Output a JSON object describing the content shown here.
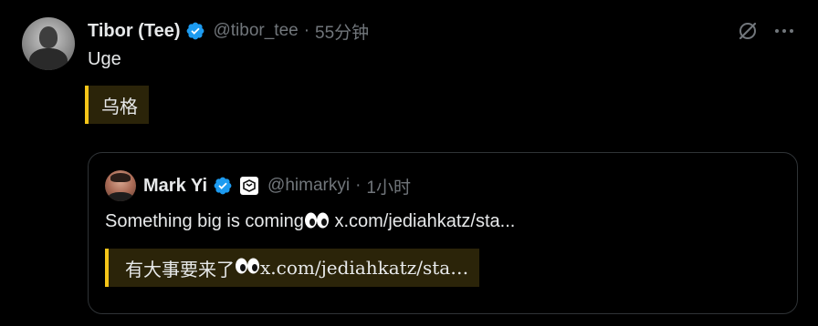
{
  "tweet": {
    "author_name": "Tibor (Tee)",
    "handle": "@tibor_tee",
    "separator": "·",
    "time": "55分钟",
    "text": "Uge",
    "translation": "乌格"
  },
  "quoted_tweet": {
    "author_name": "Mark Yi",
    "handle": "@himarkyi",
    "separator": "·",
    "time": "1小时",
    "text_before_emoji": "Something big is coming",
    "text_after_emoji": " x.com/jediahkatz/sta...",
    "translation_before_emoji": "有大事要来了 ",
    "translation_after_emoji": " x.com/jediahkatz/sta…"
  },
  "icons": {
    "verified": "verified-badge-icon",
    "affiliate": "affiliate-badge-icon",
    "grok": "grok-icon",
    "more": "more-options-icon",
    "emoji": "eyes-emoji-icon"
  },
  "colors": {
    "background": "#000000",
    "text": "#e7e9ea",
    "muted": "#71767b",
    "verified_blue": "#1d9bf0",
    "translation_accent": "#f5c518",
    "translation_bg": "#2b2409",
    "border": "#2f3336"
  }
}
